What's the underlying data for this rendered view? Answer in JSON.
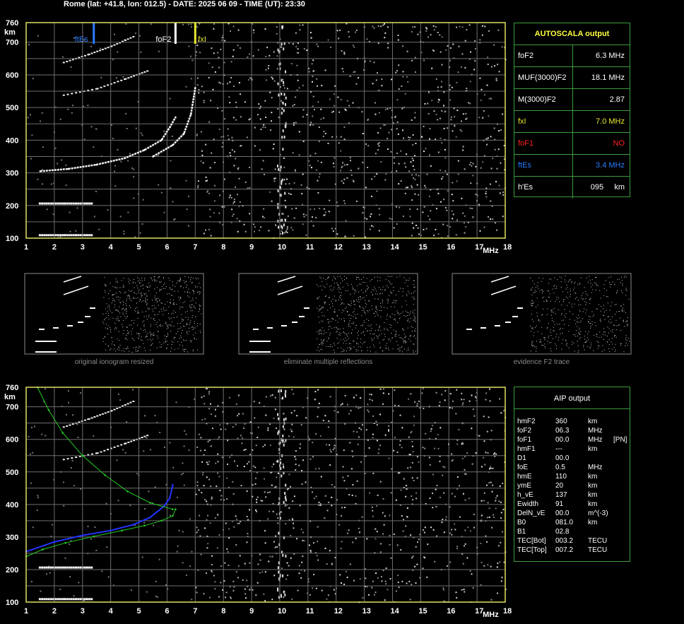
{
  "header": {
    "title": "Rome (lat: +41.8, lon: 012.5) - DATE: 2025 06 09 - TIME (UT): 23:30"
  },
  "colors": {
    "frame": "#e0e060",
    "grid": "#6e6e6e",
    "table_border": "#3c9c3c",
    "foF2": "#ffffff",
    "fxI": "#e8e830",
    "foF1": "#ff2020",
    "ftEs": "#2a7cff",
    "green_curve": "#22cc22",
    "blue_profile": "#2233ff"
  },
  "axis": {
    "km_label": "km",
    "mhz_label": "MHz",
    "y_ticks": [
      "100",
      "200",
      "300",
      "400",
      "500",
      "600",
      "700",
      "760"
    ],
    "x_ticks": [
      "1",
      "2",
      "3",
      "4",
      "5",
      "6",
      "7",
      "8",
      "9",
      "10",
      "11",
      "12",
      "13",
      "14",
      "15",
      "16",
      "17",
      "18"
    ]
  },
  "markers": {
    "ftEs": "ftEs",
    "foF2": "foF2",
    "fxI": "fxI"
  },
  "autoscala": {
    "title": "AUTOSCALA output",
    "rows": [
      {
        "label": "foF2",
        "value": "6.3 MHz",
        "color": "#ffffff"
      },
      {
        "label": "MUF(3000)F2",
        "value": "18.1 MHz",
        "color": "#ffffff"
      },
      {
        "label": "M(3000)F2",
        "value": "2.87",
        "color": "#ffffff"
      },
      {
        "label": "fxI",
        "value": "7.0 MHz",
        "color": "#e8e830"
      },
      {
        "label": "foF1",
        "value": "NO",
        "color": "#ff2020"
      },
      {
        "label": "ftEs",
        "value": "3.4 MHz",
        "color": "#2a7cff"
      },
      {
        "label": "h'Es",
        "value": "095     km",
        "color": "#ffffff"
      }
    ]
  },
  "thumbnails": [
    {
      "label": "original ionogram resized"
    },
    {
      "label": "eliminate multiple reflections"
    },
    {
      "label": "evidence F2 trace"
    }
  ],
  "aip": {
    "title": "AIP output",
    "rows": [
      {
        "name": "hmF2",
        "value": "360",
        "unit": "km",
        "extra": ""
      },
      {
        "name": "foF2",
        "value": "06.3",
        "unit": "MHz",
        "extra": ""
      },
      {
        "name": "foF1",
        "value": "00.0",
        "unit": "MHz",
        "extra": "[PN]"
      },
      {
        "name": "hmF1",
        "value": "---",
        "unit": "km",
        "extra": ""
      },
      {
        "name": "D1",
        "value": "00.0",
        "unit": "",
        "extra": ""
      },
      {
        "name": "foE",
        "value": "0.5",
        "unit": "MHz",
        "extra": ""
      },
      {
        "name": "hmE",
        "value": "110",
        "unit": "km",
        "extra": ""
      },
      {
        "name": "ymE",
        "value": "20",
        "unit": "km",
        "extra": ""
      },
      {
        "name": "h_vE",
        "value": "137",
        "unit": "km",
        "extra": ""
      },
      {
        "name": "Ewidth",
        "value": "91",
        "unit": "km",
        "extra": ""
      },
      {
        "name": "DelN_vE",
        "value": "00.0",
        "unit": "m^(-3)",
        "extra": ""
      },
      {
        "name": "B0",
        "value": "081.0",
        "unit": "km",
        "extra": ""
      },
      {
        "name": "B1",
        "value": "02.8",
        "unit": "",
        "extra": ""
      },
      {
        "name": "TEC[Bot]",
        "value": "003.2",
        "unit": "TECU",
        "extra": ""
      },
      {
        "name": "TEC[Top]",
        "value": "007.2",
        "unit": "TECU",
        "extra": ""
      }
    ]
  },
  "chart_data": [
    {
      "type": "scatter",
      "xlim": [
        1,
        18
      ],
      "ylim": [
        100,
        760
      ],
      "grid": true,
      "xlabel": "MHz",
      "ylabel": "km",
      "series": [
        {
          "name": "foF2",
          "values": [
            [
              1.5,
              305
            ],
            [
              2.5,
              312
            ],
            [
              3.5,
              325
            ],
            [
              4.5,
              345
            ],
            [
              5.2,
              370
            ],
            [
              5.8,
              400
            ],
            [
              6.1,
              440
            ],
            [
              6.3,
              470
            ]
          ]
        },
        {
          "name": "fxI",
          "values": [
            [
              5.5,
              350
            ],
            [
              6.2,
              385
            ],
            [
              6.6,
              420
            ],
            [
              6.85,
              480
            ],
            [
              7.0,
              560
            ]
          ]
        }
      ],
      "vertical_markers": [
        {
          "name": "ftEs",
          "x": 3.4
        },
        {
          "name": "foF2",
          "x": 6.3
        },
        {
          "name": "fxI",
          "x": 7.0
        }
      ]
    },
    {
      "type": "scatter",
      "xlim": [
        1,
        18
      ],
      "ylim": [
        100,
        760
      ],
      "grid": true,
      "xlabel": "MHz",
      "ylabel": "km",
      "series": [
        {
          "name": "blue_profile",
          "values": [
            [
              1.0,
              255
            ],
            [
              2.0,
              285
            ],
            [
              3.0,
              305
            ],
            [
              4.0,
              320
            ],
            [
              4.8,
              338
            ],
            [
              5.4,
              360
            ],
            [
              5.9,
              395
            ],
            [
              6.1,
              420
            ],
            [
              6.2,
              460
            ]
          ]
        },
        {
          "name": "green_upper",
          "values": [
            [
              1.4,
              760
            ],
            [
              1.8,
              690
            ],
            [
              2.3,
              620
            ],
            [
              3.0,
              550
            ],
            [
              3.8,
              490
            ],
            [
              4.6,
              440
            ],
            [
              5.4,
              405
            ],
            [
              6.2,
              385
            ]
          ]
        },
        {
          "name": "green_lower",
          "values": [
            [
              1.0,
              240
            ],
            [
              1.6,
              262
            ],
            [
              2.4,
              282
            ],
            [
              3.4,
              302
            ],
            [
              4.4,
              320
            ],
            [
              5.2,
              335
            ],
            [
              5.8,
              350
            ],
            [
              6.2,
              365
            ],
            [
              6.3,
              385
            ]
          ]
        }
      ]
    }
  ]
}
